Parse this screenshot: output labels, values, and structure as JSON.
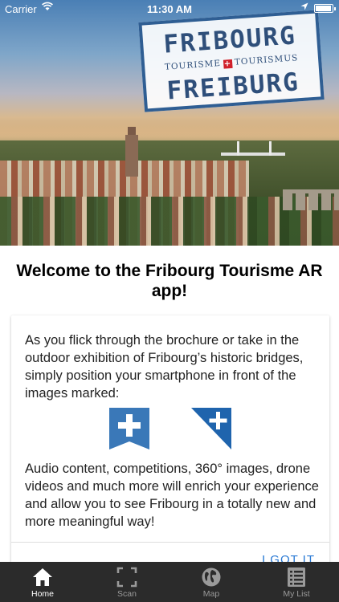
{
  "status_bar": {
    "carrier": "Carrier",
    "time": "11:30 AM"
  },
  "logo": {
    "line1": "FRIBOURG",
    "line2_left": "TOURISME",
    "line2_right": "TOURISMUS",
    "line3": "FREIBURG",
    "cross_glyph": "+"
  },
  "welcome": {
    "title": "Welcome to the Fribourg Tourisme AR app!"
  },
  "card": {
    "intro": "As you flick through the brochure or take in the outdoor exhibition of Fribourg’s historic bridges, simply position your smartphone in front of the images marked:",
    "outro": "Audio content, competitions, 360° images, drone videos and much more will enrich your experience and allow you to see Fribourg in a totally new and more meaningful way!",
    "button": "I GOT IT"
  },
  "tabbar": {
    "items": [
      {
        "label": "Home",
        "icon": "home-icon",
        "active": true
      },
      {
        "label": "Scan",
        "icon": "scan-icon",
        "active": false
      },
      {
        "label": "Map",
        "icon": "globe-icon",
        "active": false
      },
      {
        "label": "My List",
        "icon": "list-icon",
        "active": false
      }
    ]
  },
  "colors": {
    "accent": "#2a7ad4",
    "marker_blue": "#3a78b8",
    "logo_blue": "#2f5e93",
    "tabbar_bg": "#2b2b2b"
  }
}
